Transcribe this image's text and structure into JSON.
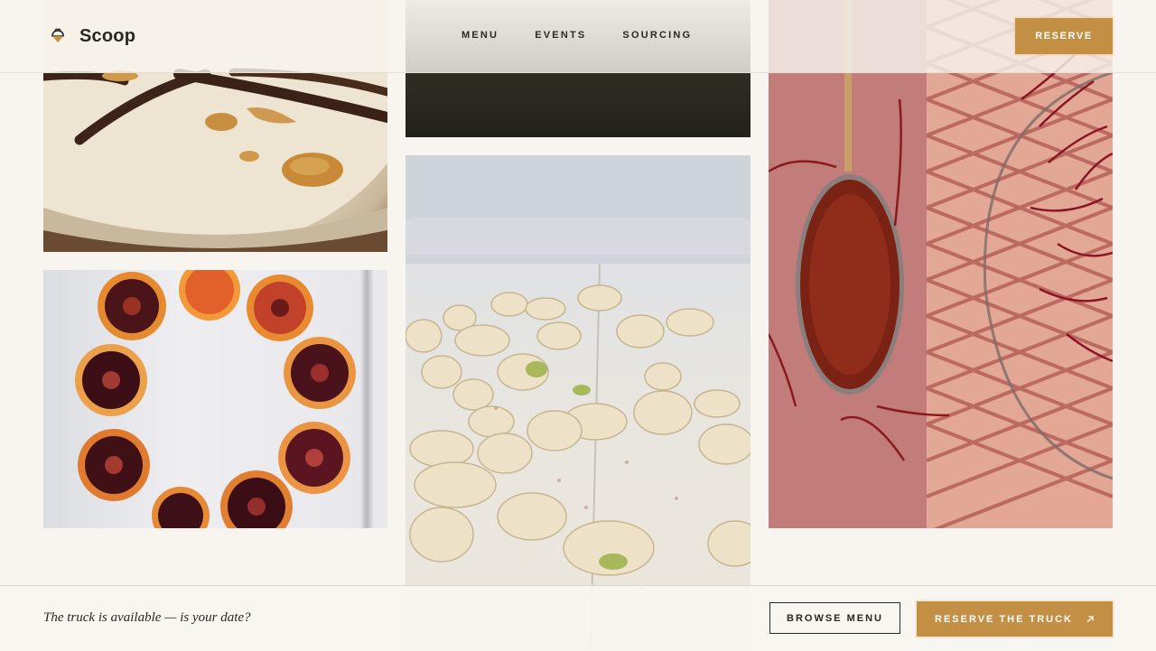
{
  "header": {
    "brand_name": "Scoop",
    "brand_icon": "ice-cream-scoop-icon",
    "nav": [
      "MENU",
      "EVENTS",
      "SOURCING"
    ],
    "reserve_label": "RESERVE"
  },
  "gallery": {
    "images": [
      "vanilla-beans-with-syrup",
      "dark-food-photo",
      "pistachios-on-table",
      "blood-orange-slices",
      "saffron-spoon-and-basket"
    ]
  },
  "footer": {
    "tagline": "The truck is available — is your date?",
    "browse_label": "BROWSE MENU",
    "reserve_truck_label": "RESERVE THE TRUCK",
    "reserve_truck_icon": "arrow-up-right-icon"
  },
  "colors": {
    "accent": "#c28f45",
    "background": "#f8f5f0",
    "text": "#2b2723"
  }
}
